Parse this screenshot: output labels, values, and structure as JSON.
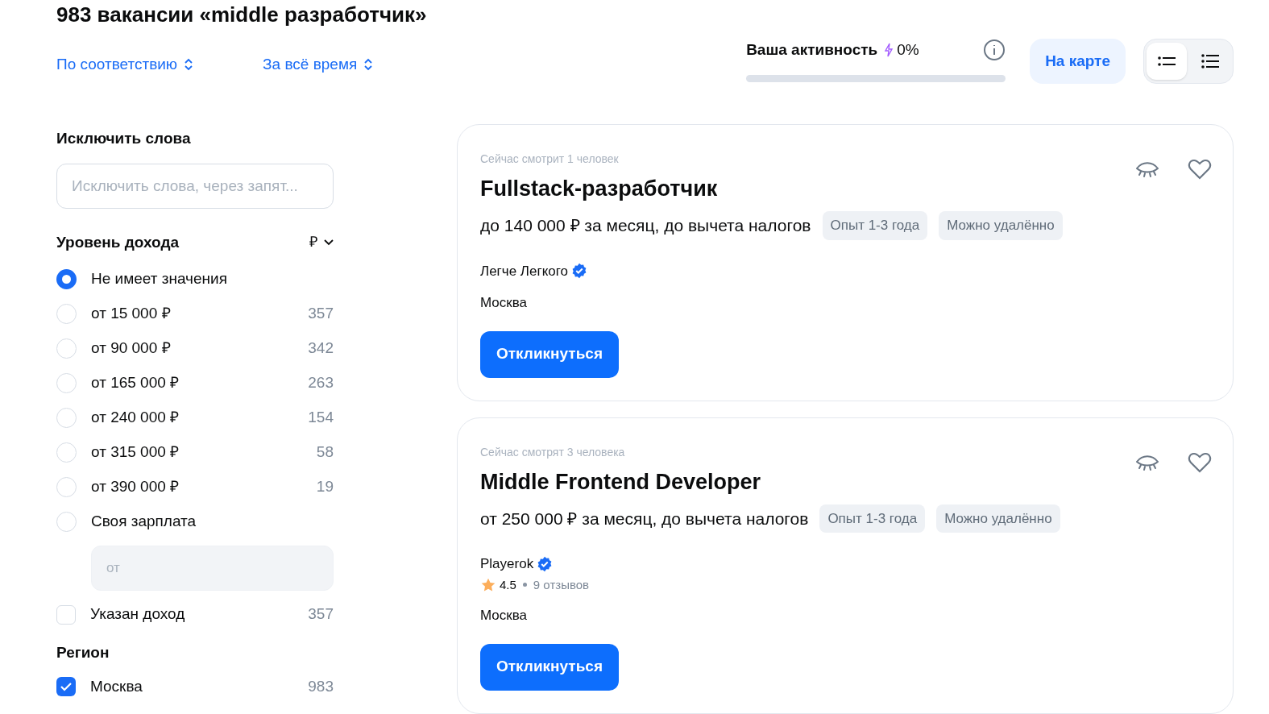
{
  "title": "983 вакансии «middle разработчик»",
  "sort": [
    {
      "label": "По соответствию"
    },
    {
      "label": "За всё время"
    }
  ],
  "activity": {
    "label": "Ваша активность",
    "value": "0%",
    "level": 0
  },
  "map_button": "На карте",
  "view_toggle": [
    {
      "kind": "compact",
      "selected": true
    },
    {
      "kind": "detailed",
      "selected": false
    }
  ],
  "filters": {
    "exclude": {
      "title": "Исключить слова",
      "placeholder": "Исключить слова, через запят..."
    },
    "income": {
      "title": "Уровень дохода",
      "currency": "₽",
      "options": [
        {
          "label": "Не имеет значения",
          "selected": true
        },
        {
          "label": "от 15 000 ₽",
          "count": "357",
          "selected": false
        },
        {
          "label": "от 90 000 ₽",
          "count": "342",
          "selected": false
        },
        {
          "label": "от 165 000 ₽",
          "count": "263",
          "selected": false
        },
        {
          "label": "от 240 000 ₽",
          "count": "154",
          "selected": false
        },
        {
          "label": "от 315 000 ₽",
          "count": "58",
          "selected": false
        },
        {
          "label": "от 390 000 ₽",
          "count": "19",
          "selected": false
        },
        {
          "label": "Своя зарплата",
          "selected": false
        }
      ],
      "custom_placeholder": "от",
      "specified": {
        "label": "Указан доход",
        "count": "357",
        "checked": false
      }
    },
    "region": {
      "title": "Регион",
      "items": [
        {
          "label": "Москва",
          "count": "983",
          "checked": true
        }
      ]
    }
  },
  "vacancies": [
    {
      "viewers": "Сейчас смотрит 1 человек",
      "title": "Fullstack-разработчик",
      "salary": "до 140 000 ₽ за месяц, до вычета налогов",
      "tags": [
        "Опыт 1-3 года",
        "Можно удалённо"
      ],
      "company": "Легче Легкого",
      "verified": true,
      "city": "Москва",
      "button": "Откликнуться"
    },
    {
      "viewers": "Сейчас смотрят 3 человека",
      "title": "Middle Frontend Developer",
      "salary": "от 250 000 ₽ за месяц, до вычета налогов",
      "tags": [
        "Опыт 1-3 года",
        "Можно удалённо"
      ],
      "company": "Playerok",
      "verified": true,
      "rating": "4.5",
      "reviews": "9 отзывов",
      "city": "Москва",
      "button": "Откликнуться"
    }
  ]
}
